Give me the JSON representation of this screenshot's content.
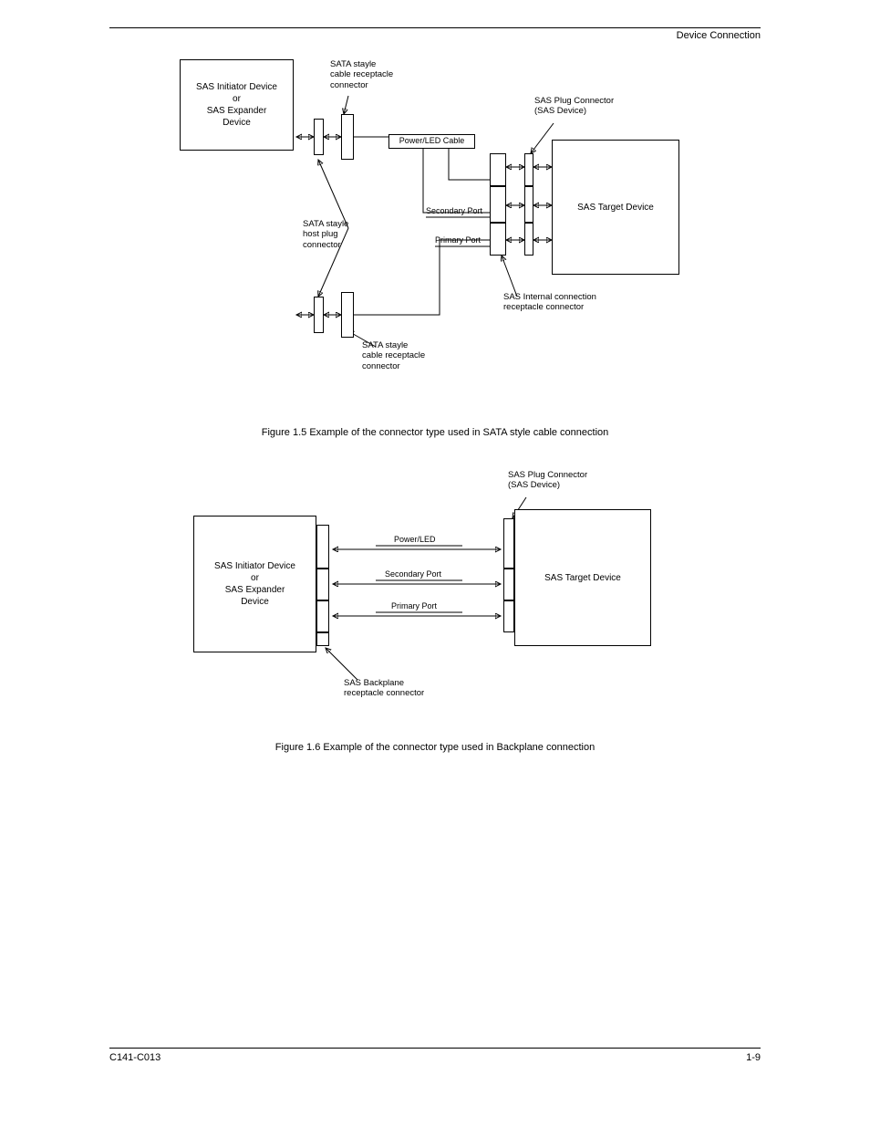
{
  "header": {
    "right": "Device Connection"
  },
  "fig1": {
    "caption": "Figure 1.5   Example of the connector type used in SATA style cable connection",
    "sas_initiator_top": "SAS Initiator Device\nor\nSAS Expander\nDevice",
    "sas_initiator_bottom": "SAS Initiator Device\nor\nSAS Expander\nDevice",
    "target": "SAS Target Device",
    "sata_cable_recept_top": "SATA stayle\ncable receptacle\nconnector",
    "sata_cable_recept_bottom": "SATA stayle\ncable receptacle\nconnector",
    "sata_host_plug": "SATA stayle\nhost plug\nconnector",
    "sas_plug_conn": "SAS Plug Connector\n(SAS Device)",
    "sas_internal_conn": "SAS Internal connection\nreceptacle connector",
    "power_led_cable": "Power/LED Cable",
    "secondary_port": "Secondary Port",
    "primary_port": "Primary Port"
  },
  "fig2": {
    "caption": "Figure 1.6  Example of the connector type used in Backplane connection",
    "sas_initiator": "SAS Initiator Device\nor\nSAS Expander\nDevice",
    "target": "SAS Target Device",
    "power_led": "Power/LED",
    "secondary_port": "Secondary Port",
    "primary_port": "Primary Port",
    "sas_plug_conn": "SAS Plug Connector\n(SAS Device)",
    "backplane_recept": "SAS Backplane\nreceptacle connector"
  },
  "footer": {
    "left": "C141-C013",
    "right": "1-9"
  }
}
